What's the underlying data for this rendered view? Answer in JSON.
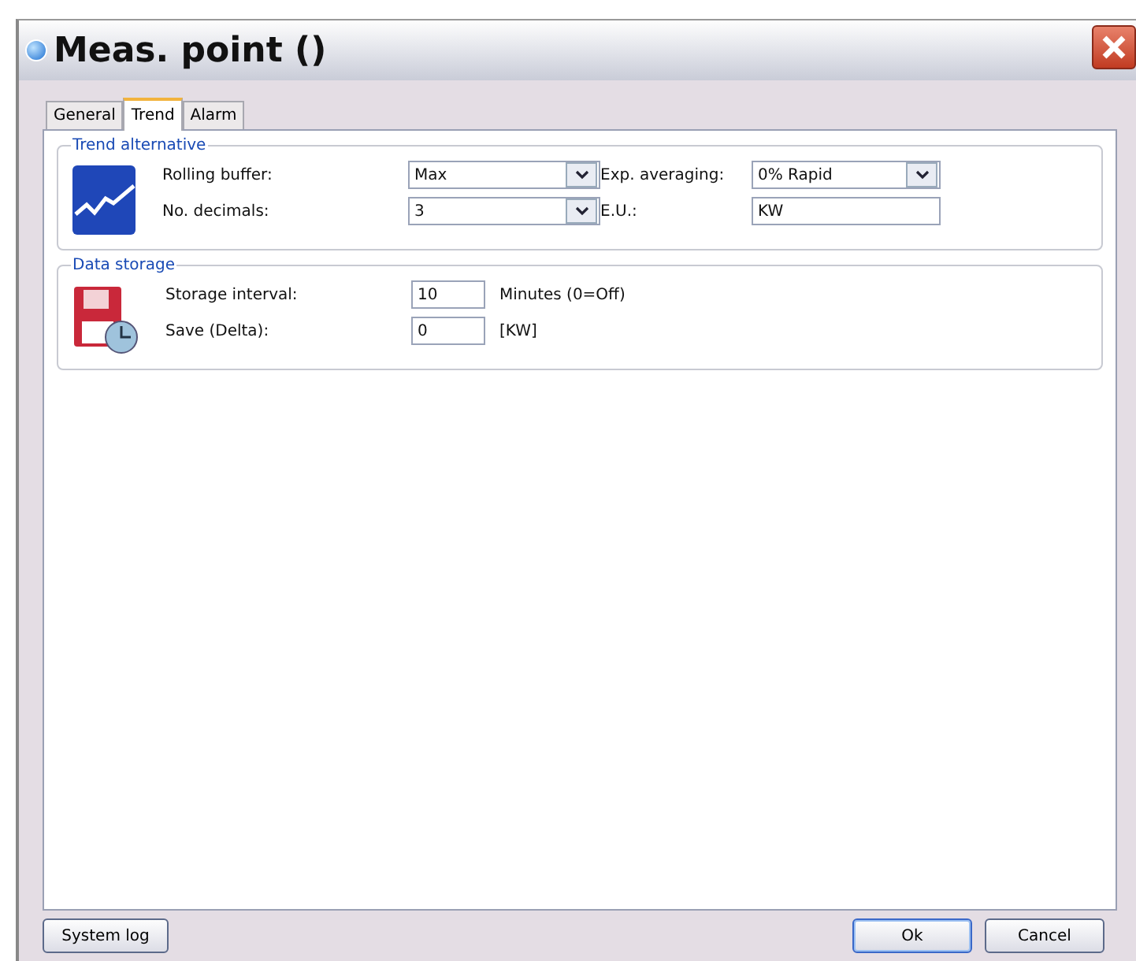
{
  "window": {
    "title": "Meas. point ()"
  },
  "tabs": [
    {
      "label": "General",
      "selected": false
    },
    {
      "label": "Trend",
      "selected": true
    },
    {
      "label": "Alarm",
      "selected": false
    }
  ],
  "trend_alternative": {
    "title": "Trend alternative",
    "fields": [
      {
        "kind": "combo",
        "label": "Rolling buffer:",
        "value": "Max"
      },
      {
        "kind": "combo",
        "label": "Exp. averaging:",
        "value": "0% Rapid"
      },
      {
        "kind": "combo",
        "label": "No. decimals:",
        "value": "3"
      },
      {
        "kind": "text",
        "label": "E.U.:",
        "value": "KW"
      }
    ]
  },
  "data_storage": {
    "title": "Data storage",
    "fields": [
      {
        "label": "Storage interval:",
        "value": "10",
        "unit": "Minutes (0=Off)"
      },
      {
        "label": "Save (Delta):",
        "value": "0",
        "unit": "[KW]"
      }
    ]
  },
  "buttons": {
    "left": [
      "System log"
    ],
    "right": [
      "Ok",
      "Cancel"
    ]
  }
}
